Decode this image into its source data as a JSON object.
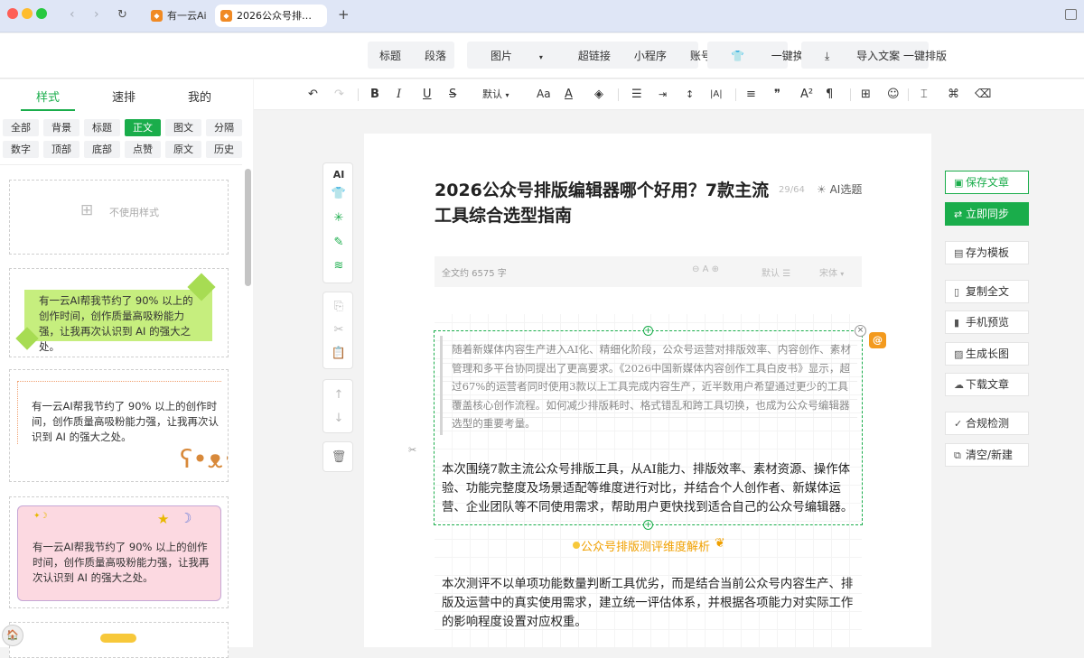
{
  "browser": {
    "tabs": [
      {
        "label": "有一云Ai",
        "active": false
      },
      {
        "label": "2026公众号排…",
        "active": true
      }
    ],
    "new_tab": "+",
    "traffic_colors": [
      "#fe5f57",
      "#febc2e",
      "#28c840"
    ]
  },
  "insert_toolbar": {
    "group1": [
      "标题",
      "段落"
    ],
    "group2": [
      "图片",
      "超链接",
      "小程序",
      "账号名片"
    ],
    "skin": "一键换肤",
    "import": "导入文案 一键排版"
  },
  "left_tabs": [
    "样式",
    "速排",
    "我的"
  ],
  "categories": [
    "全部",
    "背景",
    "标题",
    "正文",
    "图文",
    "分隔",
    "数字",
    "顶部",
    "底部",
    "点赞",
    "原文",
    "历史"
  ],
  "active_category": "正文",
  "format_toolbar": {
    "font_size_label": "默认"
  },
  "styles": {
    "none_label": "不使用样式",
    "sample1": "有一云AI帮我节约了 90% 以上的创作时间，创作质量高吸粉能力强，让我再次认识到 AI 的强大之处。",
    "sample2": "有一云AI帮我节约了 90% 以上的创作时间，创作质量高吸粉能力强，让我再次认识到 AI 的强大之处。",
    "sample3": "有一云AI帮我节约了 90% 以上的创作时间，创作质量高吸粉能力强，让我再次认识到 AI 的强大之处。"
  },
  "vertical_tools": {
    "ai_label": "AI"
  },
  "article": {
    "title": "2026公众号排版编辑器哪个好用？7款主流工具综合选型指南",
    "title_count": "29/64",
    "ai_topic": "AI选题",
    "word_count": "全文约 6575 字",
    "font_a": "A",
    "spacing": "默认",
    "font_name": "宋体",
    "quote": "随着新媒体内容生产进入AI化、精细化阶段，公众号运营对排版效率、内容创作、素材管理和多平台协同提出了更高要求。《2026中国新媒体内容创作工具白皮书》显示，超过67%的运营者同时使用3款以上工具完成内容生产，近半数用户希望通过更少的工具覆盖核心创作流程。如何减少排版耗时、格式错乱和跨工具切换，也成为公众号编辑器选型的重要考量。",
    "para1": "本次围绕7款主流公众号排版工具，从AI能力、排版效率、素材资源、操作体验、功能完整度及场景适配等维度进行对比，并结合个人创作者、新媒体运营、企业团队等不同使用需求，帮助用户更快找到适合自己的公众号编辑器。",
    "section_title": "公众号排版测评维度解析",
    "para2": "本次测评不以单项功能数量判断工具优劣，而是结合当前公众号内容生产、排版及运营中的真实使用需求，建立统一评估体系，并根据各项能力对实际工作的影响程度设置对应权重。"
  },
  "right_actions": {
    "save": "保存文章",
    "sync": "立即同步",
    "template": "存为模板",
    "copy": "复制全文",
    "preview": "手机预览",
    "longimg": "生成长图",
    "download": "下载文章",
    "compliance": "合规检测",
    "clear": "清空/新建"
  },
  "colors": {
    "accent": "#1aad4b",
    "orange": "#f0a000"
  }
}
